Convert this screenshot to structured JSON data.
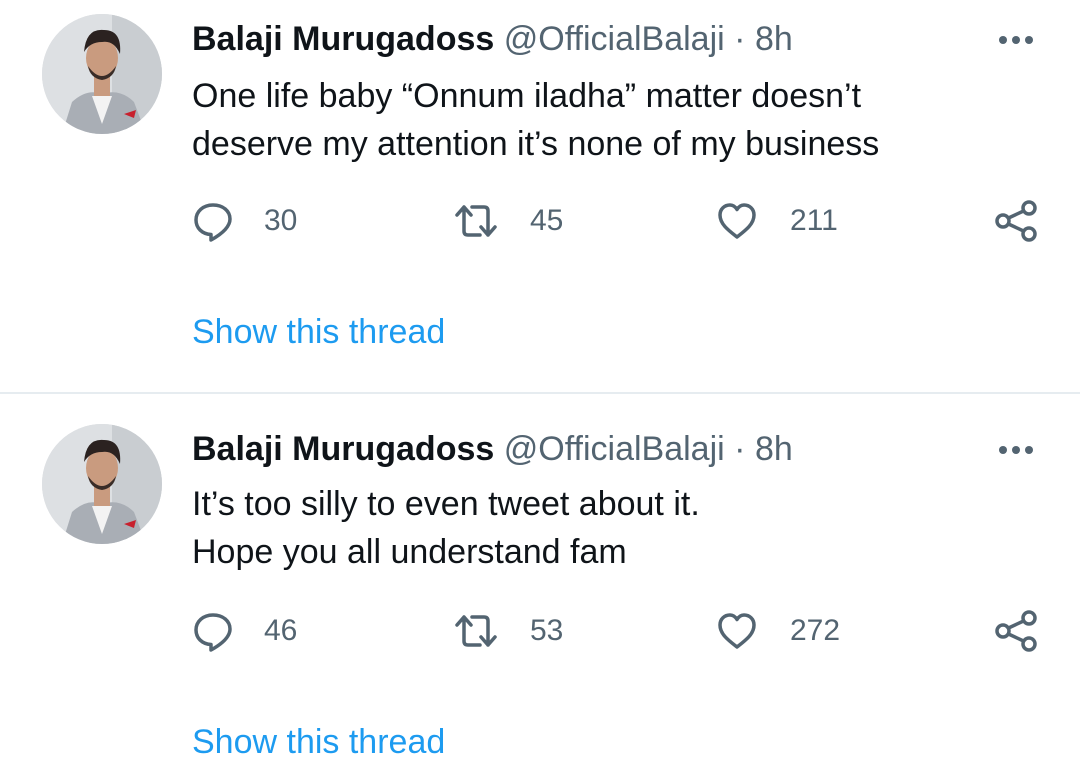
{
  "tweets": [
    {
      "author_name": "Balaji Murugadoss",
      "handle": "@OfficialBalaji",
      "separator": "·",
      "time": "8h",
      "text_lines": [
        "One life baby “Onnum iladha” matter doesn’t",
        "deserve my attention it’s none of my business"
      ],
      "replies": "30",
      "retweets": "45",
      "likes": "211",
      "thread_link": "Show this thread"
    },
    {
      "author_name": "Balaji Murugadoss",
      "handle": "@OfficialBalaji",
      "separator": "·",
      "time": "8h",
      "text_lines": [
        "It’s too silly to even tweet about it.",
        "Hope you all understand fam"
      ],
      "replies": "46",
      "retweets": "53",
      "likes": "272",
      "thread_link": "Show this thread"
    }
  ],
  "icons": {
    "reply": "reply-icon",
    "retweet": "retweet-icon",
    "like": "heart-icon",
    "share": "share-icon",
    "more": "more-options-icon"
  },
  "colors": {
    "link": "#1d9bf0",
    "secondary_text": "#536471",
    "primary_text": "#0f1419",
    "divider": "#e6ecf0"
  }
}
